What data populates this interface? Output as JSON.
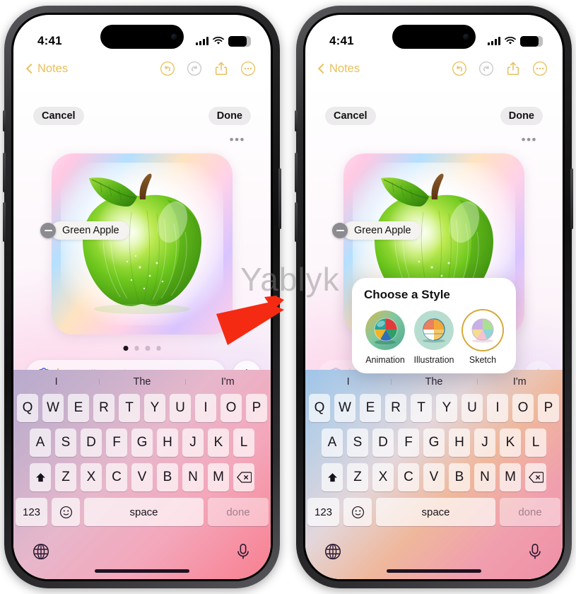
{
  "meta": {
    "watermark": "Yablyk",
    "accent_gold": "#E8C15C",
    "arrow_color": "#F52A12"
  },
  "status_bar": {
    "time": "4:41",
    "battery_percent": "79",
    "signal_icon": "cellular-signal-icon",
    "wifi_icon": "wifi-icon",
    "battery_icon": "battery-icon"
  },
  "nav_bar": {
    "back_label": "Notes",
    "back_icon": "chevron-left-icon",
    "undo_icon": "undo-icon",
    "redo_icon": "redo-icon",
    "share_icon": "share-icon",
    "more_icon": "more-circle-icon"
  },
  "editor": {
    "cancel_label": "Cancel",
    "done_label": "Done",
    "overflow_label": "•••",
    "chip": {
      "label": "Green Apple",
      "remove_icon": "minus-circle-icon"
    },
    "image_alt": "green-apple-illustration",
    "page_dots": {
      "count": 4,
      "active": 0
    },
    "prompt": {
      "placeholder": "Describe an image",
      "value": "",
      "leading_icon": "image-playground-icon",
      "add_icon": "plus-icon"
    }
  },
  "style_popup": {
    "title": "Choose a Style",
    "selected": "Sketch",
    "options": [
      {
        "label": "Animation",
        "icon": "beach-ball-animation-icon",
        "selected": false
      },
      {
        "label": "Illustration",
        "icon": "beach-ball-illustration-icon",
        "selected": false
      },
      {
        "label": "Sketch",
        "icon": "beach-ball-sketch-icon",
        "selected": true
      }
    ]
  },
  "keyboard": {
    "suggestions": [
      "I",
      "The",
      "I'm"
    ],
    "row1": [
      "Q",
      "W",
      "E",
      "R",
      "T",
      "Y",
      "U",
      "I",
      "O",
      "P"
    ],
    "row2": [
      "A",
      "S",
      "D",
      "F",
      "G",
      "H",
      "J",
      "K",
      "L"
    ],
    "row3": [
      "Z",
      "X",
      "C",
      "V",
      "B",
      "N",
      "M"
    ],
    "shift_icon": "shift-icon",
    "backspace_icon": "backspace-icon",
    "numbers_label": "123",
    "emoji_icon": "emoji-icon",
    "space_label": "space",
    "done_label": "done",
    "globe_icon": "globe-icon",
    "mic_icon": "microphone-icon"
  },
  "panels": {
    "left": {
      "name": "Image Playground prompt screen with add-concept arrow"
    },
    "right": {
      "name": "Image Playground with Choose a Style popup"
    }
  }
}
